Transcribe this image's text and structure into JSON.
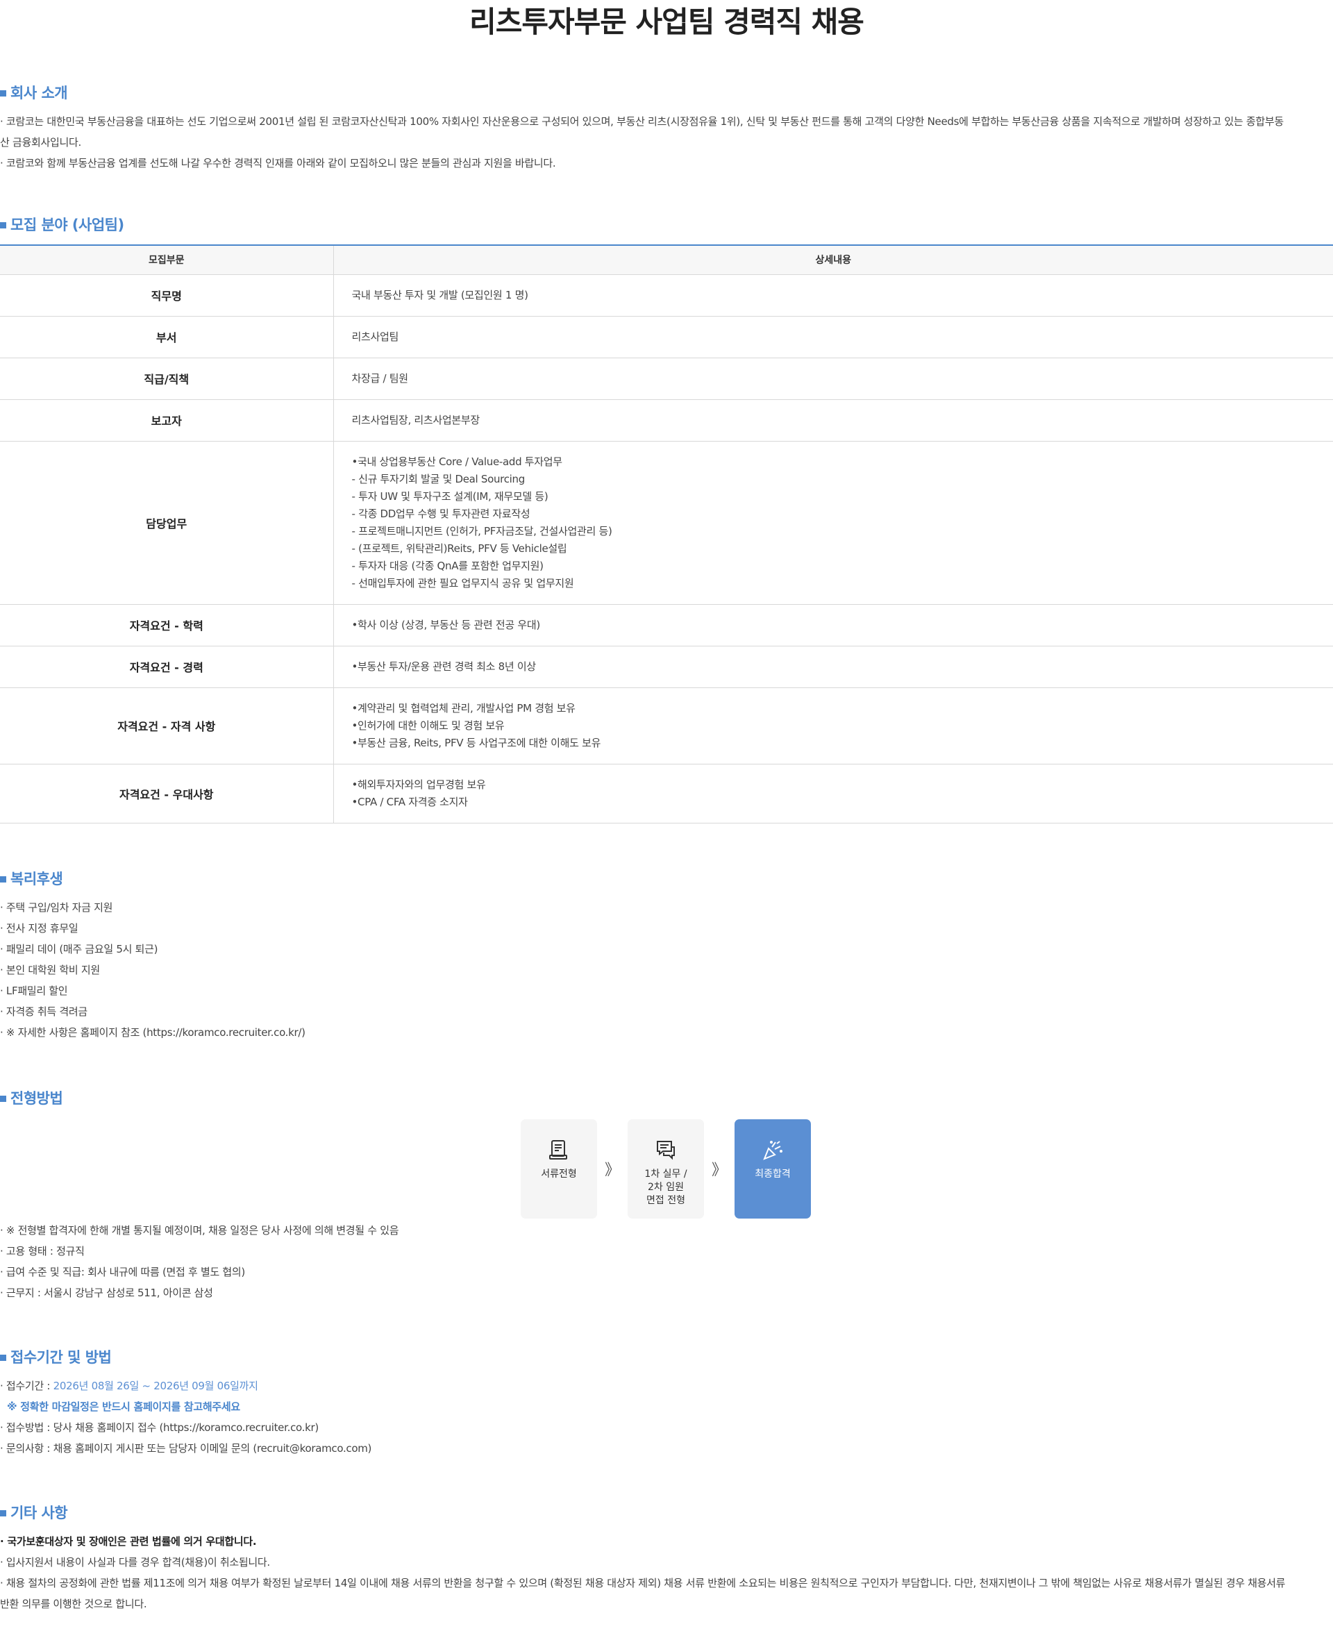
{
  "title": "리츠투자부문 사업팀 경력직 채용",
  "intro": {
    "heading": "회사 소개",
    "line1": "· 코람코는 대한민국 부동산금융을 대표하는 선도 기업으로써 2001년 설립 된 코람코자산신탁과 100% 자회사인 자산운용으로 구성되어 있으며, 부동산 리츠(시장점유율 1위), 신탁 및 부동산 펀드를 통해 고객의 다양한 Needs에 부합하는 부동산금융 상품을 지속적으로 개발하며 성장하고 있는 종합부동",
    "line2": "산 금융회사입니다.",
    "line3": "· 코람코와 함께 부동산금융 업계를 선도해 나갈 우수한 경력직 인재를 아래와 같이 모집하오니 많은 분들의 관심과 지원을 바랍니다."
  },
  "recruit": {
    "heading": "모집 분야 (사업팀)",
    "col1": "모집부문",
    "col2": "상세내용",
    "rows": [
      {
        "label": "직무명",
        "lines": [
          "국내 부동산 투자 및 개발 (모집인원 1 명)"
        ]
      },
      {
        "label": "부서",
        "lines": [
          "리츠사업팀"
        ]
      },
      {
        "label": "직급/직책",
        "lines": [
          "차장급 / 팀원"
        ]
      },
      {
        "label": "보고자",
        "lines": [
          "리츠사업팀장, 리츠사업본부장"
        ]
      },
      {
        "label": "담당업무",
        "lines": [
          "•국내 상업용부동산 Core / Value-add 투자업무",
          "- 신규 투자기회 발굴 및 Deal Sourcing",
          "- 투자 UW 및 투자구조 설계(IM, 재무모델 등)",
          "- 각종 DD업무 수행 및 투자관련 자료작성",
          "- 프로젝트매니지먼트 (인허가, PF자금조달, 건설사업관리 등)",
          "- (프로젝트, 위탁관리)Reits, PFV 등 Vehicle설립",
          "- 투자자 대응 (각종 QnA를 포함한 업무지원)",
          "- 선매입투자에 관한 필요 업무지식 공유 및 업무지원"
        ]
      },
      {
        "label": "자격요건 - 학력",
        "lines": [
          "•학사 이상 (상경, 부동산 등 관련 전공 우대)"
        ]
      },
      {
        "label": "자격요건 - 경력",
        "lines": [
          "•부동산 투자/운용 관련 경력 최소 8년 이상"
        ]
      },
      {
        "label": "자격요건 - 자격 사항",
        "lines": [
          "•계약관리 및 협력업체 관리, 개발사업 PM 경험 보유",
          "•인허가에 대한 이해도 및 경험 보유",
          "•부동산 금융, Reits, PFV 등 사업구조에 대한 이해도 보유"
        ]
      },
      {
        "label": "자격요건 - 우대사항",
        "lines": [
          "•해외투자자와의 업무경험 보유",
          "•CPA / CFA 자격증 소지자"
        ]
      }
    ]
  },
  "benefit": {
    "heading": "복리후생",
    "lines": [
      "· 주택 구입/임차 자금 지원",
      "· 전사 지정 휴무일",
      "· 패밀리 데이 (매주 금요일 5시 퇴근)",
      "· 본인 대학원 학비 지원",
      "· LF패밀리 할인",
      "· 자격증 취득 격려금",
      "· ※ 자세한 사항은 홈페이지 참조 (https://koramco.recruiter.co.kr/)"
    ]
  },
  "process": {
    "heading": "전형방법",
    "steps": [
      {
        "l1": "서류전형",
        "l2": "",
        "l3": "",
        "icon": "document-check-icon"
      },
      {
        "l1": "1차 실무 /",
        "l2": "2차 임원",
        "l3": "면접 전형",
        "icon": "chat-bubbles-icon"
      },
      {
        "l1": "최종합격",
        "l2": "",
        "l3": "",
        "icon": "party-popper-icon"
      }
    ],
    "arrow": "》",
    "lines": [
      "· ※ 전형별 합격자에 한해 개별 통지될 예정이며, 채용 일정은 당사 사정에 의해 변경될 수 있음",
      "· 고용 형태 : 정규직",
      "· 급여 수준 및 직급: 회사 내규에 따름 (면접 후 별도 협의)",
      "· 근무지 : 서울시 강남구 삼성로 511, 아이콘 삼성"
    ]
  },
  "apply": {
    "heading": "접수기간 및 방법",
    "period_label": "· 접수기간 : ",
    "period_value": "2026년 08월 26일 ~ 2026년 09월 06일까지",
    "note": "※ 정확한 마감일정은 반드시 홈페이지를 참고해주세요",
    "method": "· 접수방법 : 당사 채용 홈페이지 접수 (https://koramco.recruiter.co.kr)",
    "contact": "· 문의사항 : 채용 홈페이지 게시판 또는 담당자 이메일 문의 (recruit@koramco.com)"
  },
  "etc": {
    "heading": "기타 사항",
    "line1": "· 국가보훈대상자 및 장애인은 관련 법률에 의거 우대합니다.",
    "line2": "· 입사지원서 내용이 사실과 다를 경우 합격(채용)이 취소됩니다.",
    "line3": "· 채용 절차의 공정화에 관한 법률 제11조에 의거 채용 여부가 확정된 날로부터 14일 이내에 채용 서류의 반환을 청구할 수 있으며 (확정된 채용 대상자 제외) 채용 서류 반환에 소요되는 비용은 원칙적으로 구인자가 부담합니다. 다만, 천재지변이나 그 밖에 책임없는 사유로 채용서류가 멸실된 경우 채용서류",
    "line4": "반환 의무를 이행한 것으로 합니다."
  },
  "colors": {
    "accent": "#4a86cc",
    "final_step": "#5b8fd3"
  }
}
